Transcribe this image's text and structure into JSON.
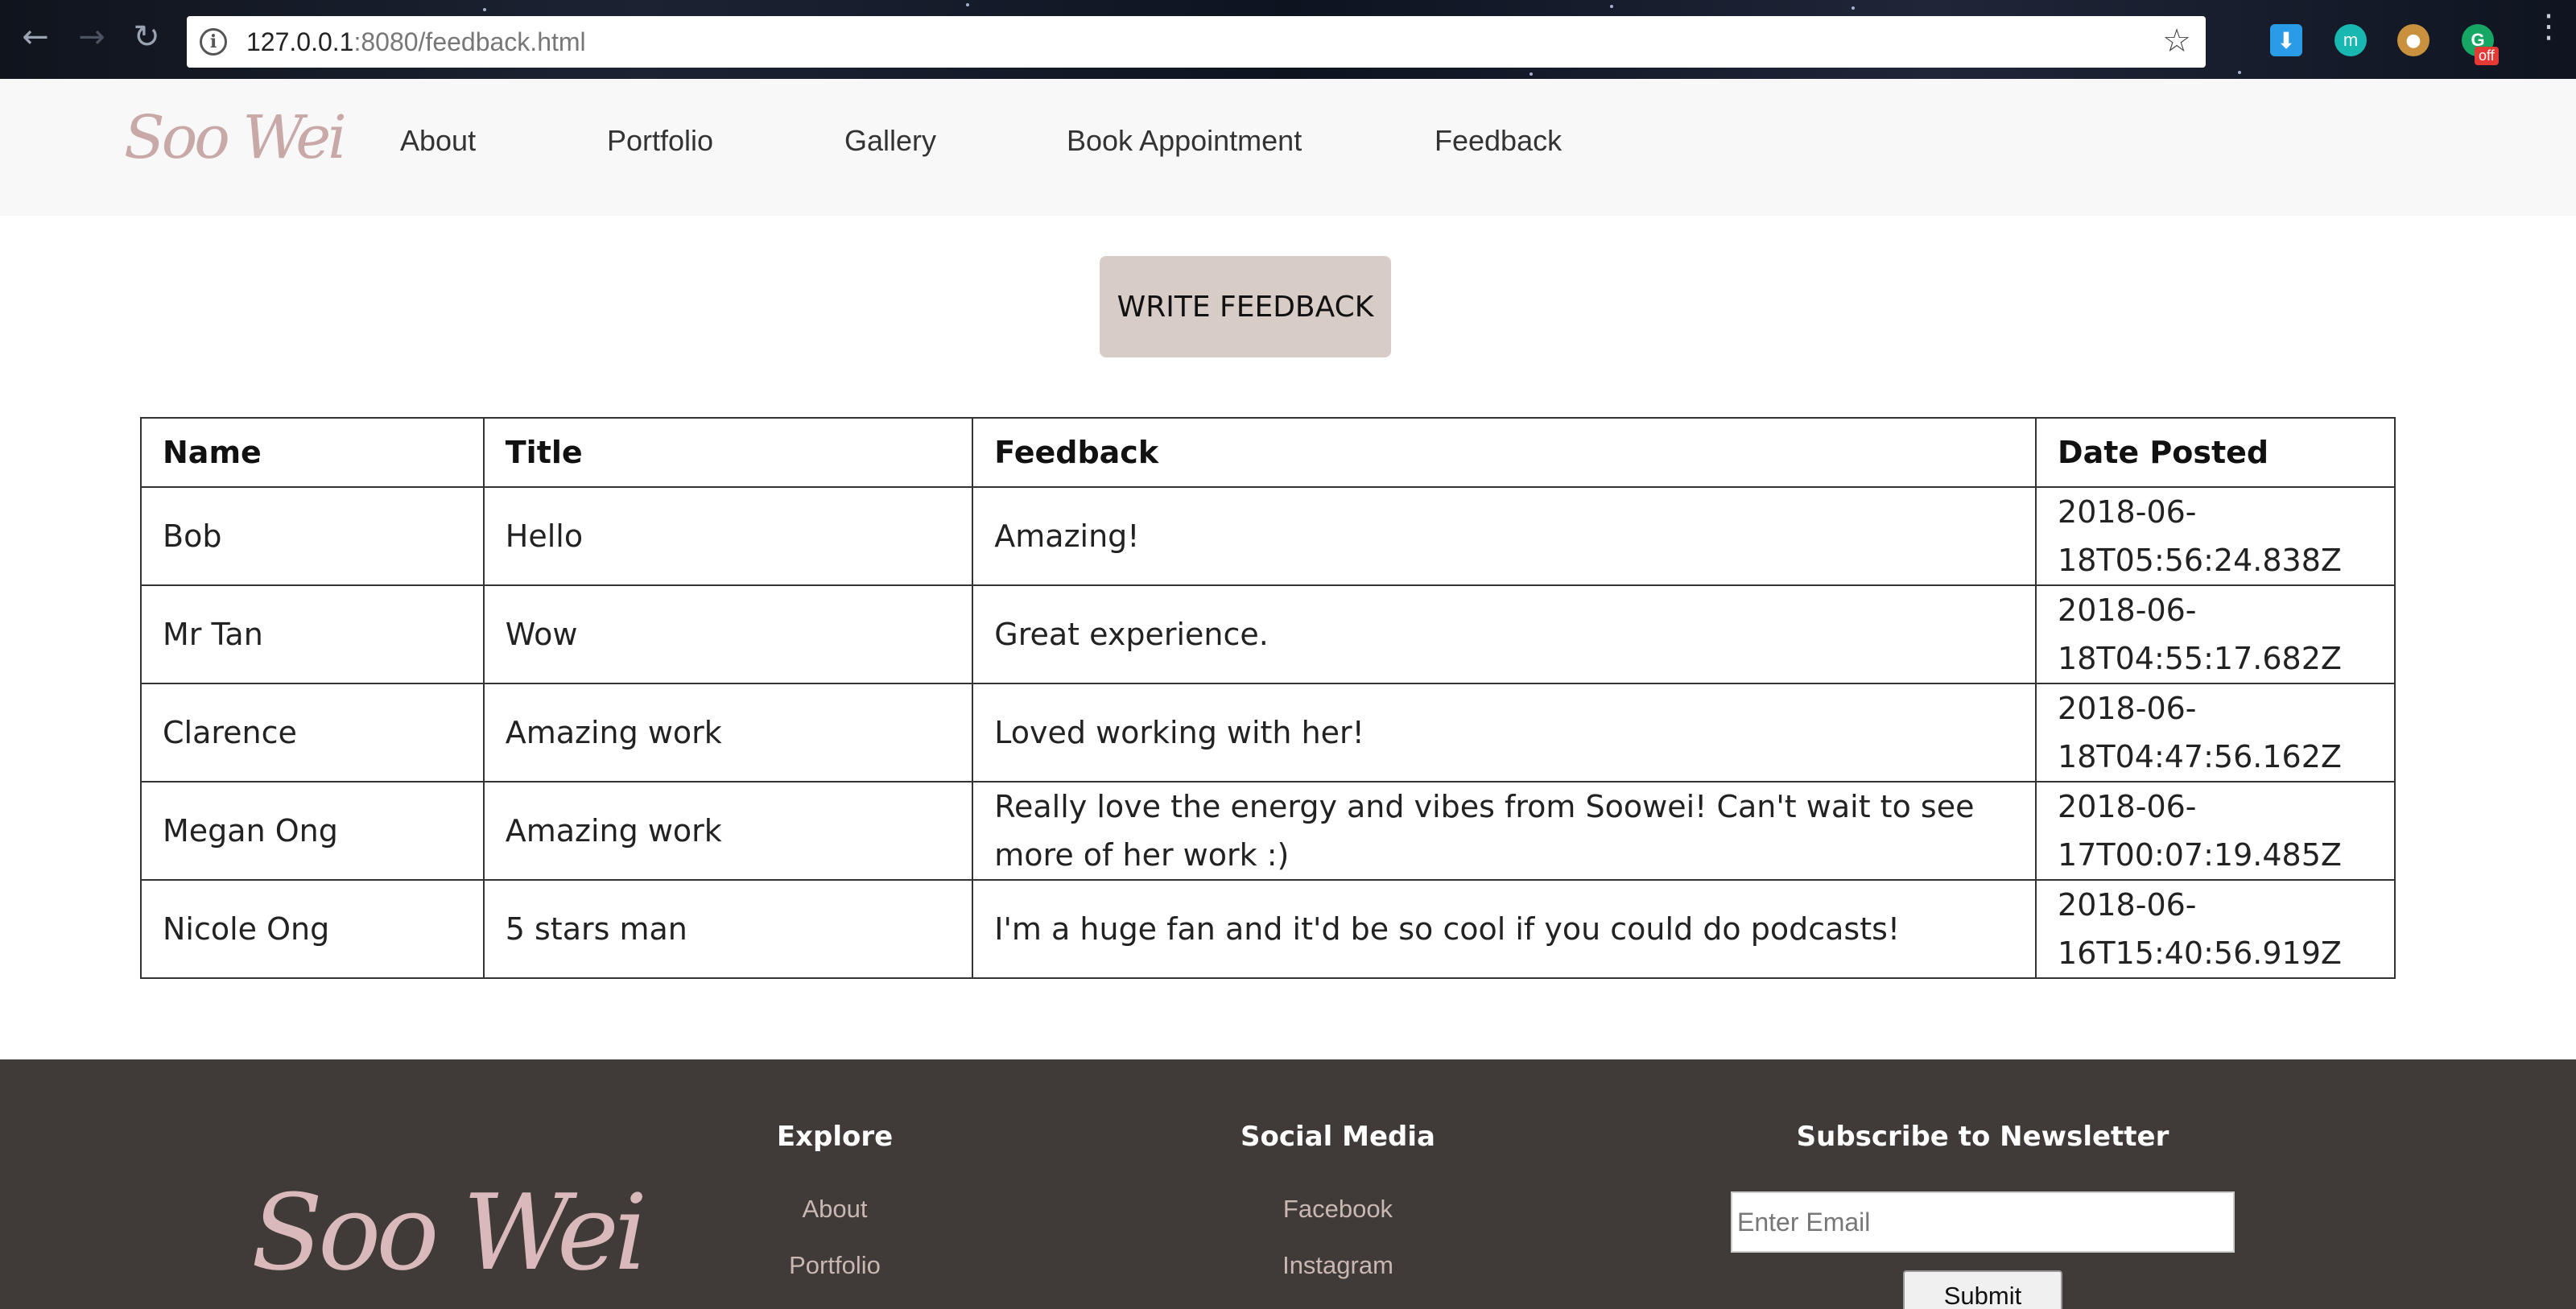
{
  "browser": {
    "url_host": "127.0.0.1",
    "url_path": ":8080/feedback.html",
    "extension_badge": "off",
    "extension_m_label": "m"
  },
  "site": {
    "logo": "Soo Wei",
    "nav": [
      {
        "label": "About"
      },
      {
        "label": "Portfolio"
      },
      {
        "label": "Gallery"
      },
      {
        "label": "Book Appointment"
      },
      {
        "label": "Feedback"
      }
    ]
  },
  "main": {
    "write_button": "WRITE FEEDBACK",
    "table": {
      "headers": [
        "Name",
        "Title",
        "Feedback",
        "Date Posted"
      ],
      "rows": [
        [
          "Bob",
          "Hello",
          "Amazing!",
          "2018-06-18T05:56:24.838Z"
        ],
        [
          "Mr Tan",
          "Wow",
          "Great experience.",
          "2018-06-18T04:55:17.682Z"
        ],
        [
          "Clarence",
          "Amazing work",
          "Loved working with her!",
          "2018-06-18T04:47:56.162Z"
        ],
        [
          "Megan Ong",
          "Amazing work",
          "Really love the energy and vibes from Soowei! Can't wait to see more of her work :)",
          "2018-06-17T00:07:19.485Z"
        ],
        [
          "Nicole Ong",
          "5 stars man",
          "I'm a huge fan and it'd be so cool if you could do podcasts!",
          "2018-06-16T15:40:56.919Z"
        ]
      ]
    }
  },
  "footer": {
    "logo": "Soo Wei",
    "explore": {
      "heading": "Explore",
      "links": [
        "About",
        "Portfolio"
      ]
    },
    "social": {
      "heading": "Social Media",
      "links": [
        "Facebook",
        "Instagram"
      ]
    },
    "newsletter": {
      "heading": "Subscribe to Newsletter",
      "placeholder": "Enter Email",
      "submit": "Submit"
    }
  }
}
